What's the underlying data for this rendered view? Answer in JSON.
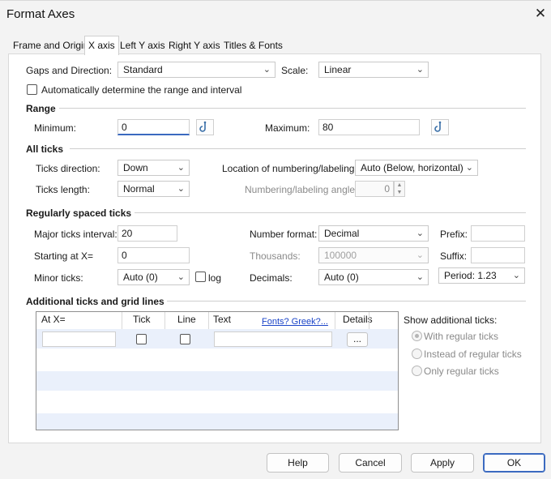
{
  "window": {
    "title": "Format Axes"
  },
  "tabs": [
    {
      "label": "Frame and Origin"
    },
    {
      "label": "X axis"
    },
    {
      "label": "Left Y axis"
    },
    {
      "label": "Right Y axis"
    },
    {
      "label": "Titles & Fonts"
    }
  ],
  "top": {
    "gaps_label": "Gaps and Direction:",
    "gaps_value": "Standard",
    "scale_label": "Scale:",
    "scale_value": "Linear",
    "auto_range_label": "Automatically determine the range and interval"
  },
  "range": {
    "heading": "Range",
    "min_label": "Minimum:",
    "min_value": "0",
    "max_label": "Maximum:",
    "max_value": "80"
  },
  "all_ticks": {
    "heading": "All ticks",
    "direction_label": "Ticks direction:",
    "direction_value": "Down",
    "location_label": "Location of numbering/labeling:",
    "location_value": "Auto (Below, horizontal)",
    "length_label": "Ticks length:",
    "length_value": "Normal",
    "angle_label": "Numbering/labeling angle:",
    "angle_value": "0"
  },
  "regular": {
    "heading": "Regularly spaced ticks",
    "major_label": "Major ticks interval:",
    "major_value": "20",
    "number_format_label": "Number format:",
    "number_format_value": "Decimal",
    "prefix_label": "Prefix:",
    "prefix_value": "",
    "start_label": "Starting at X=",
    "start_value": "0",
    "thousands_label": "Thousands:",
    "thousands_value": "100000",
    "suffix_label": "Suffix:",
    "suffix_value": "",
    "minor_label": "Minor ticks:",
    "minor_value": "Auto (0)",
    "log_label": "log",
    "decimals_label": "Decimals:",
    "decimals_value": "Auto (0)",
    "period_value": "Period: 1.23"
  },
  "additional": {
    "heading": "Additional ticks and grid lines",
    "columns": {
      "at": "At X=",
      "tick": "Tick",
      "line": "Line",
      "text": "Text",
      "fonts_link": "Fonts? Greek?...",
      "details": "Details"
    },
    "details_button": "...",
    "show_label": "Show additional ticks:",
    "options": [
      "With regular ticks",
      "Instead of regular ticks",
      "Only regular ticks"
    ]
  },
  "buttons": {
    "help": "Help",
    "cancel": "Cancel",
    "apply": "Apply",
    "ok": "OK"
  }
}
